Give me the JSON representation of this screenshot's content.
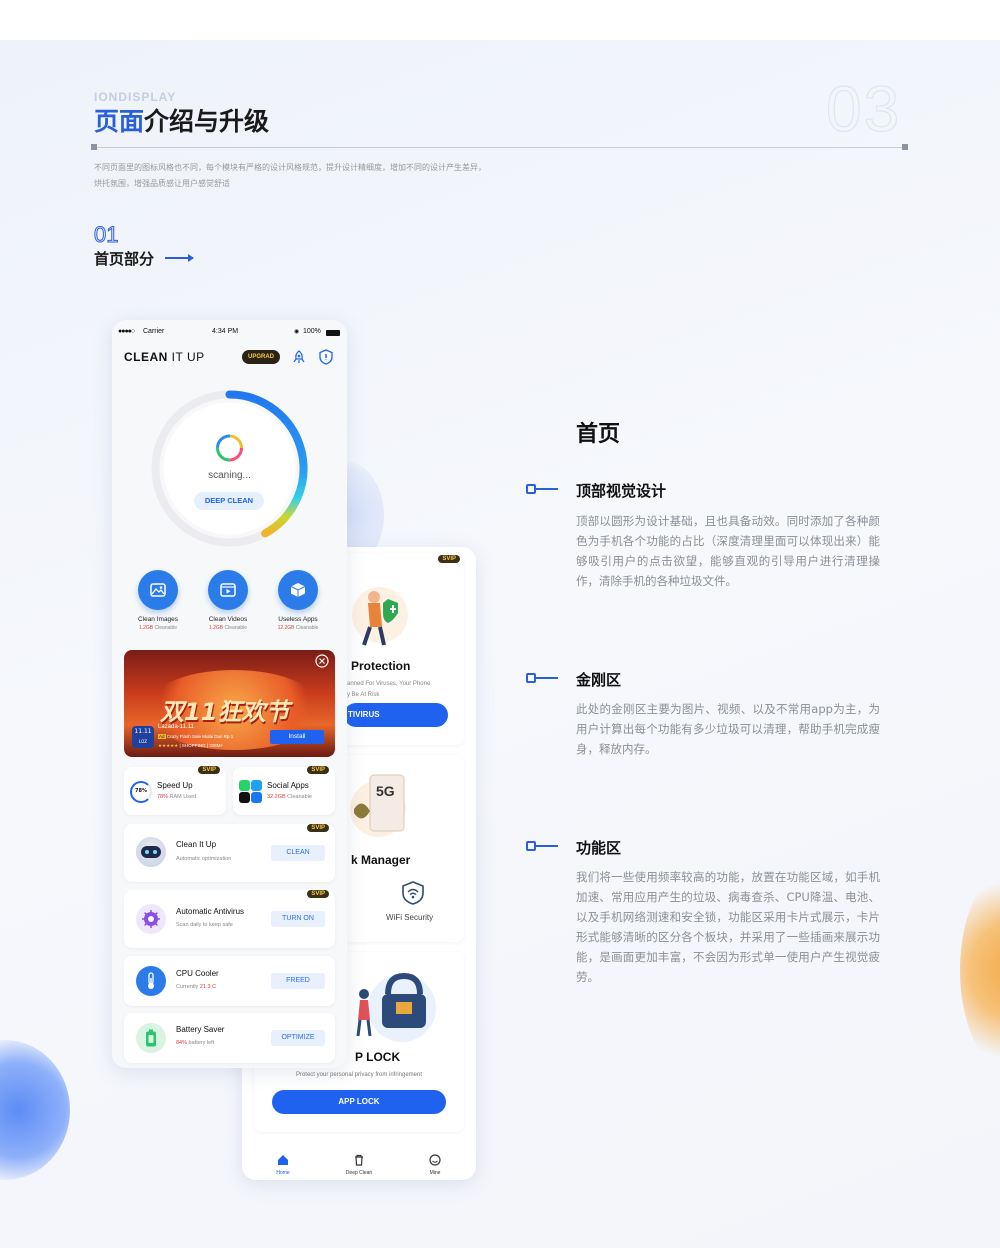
{
  "header": {
    "en_label": "IONDISPLAY",
    "title_highlight": "页面",
    "title_rest": "介绍与升级",
    "page_number": "03",
    "description_line1": "不同页面里的图标风格也不同，每个模块有严格的设计风格规范，提升设计精细度，增加不同的设计产生差异，",
    "description_line2": "烘托氛围，增强品质感让用户感觉舒适"
  },
  "section": {
    "number": "01",
    "title": "首页部分"
  },
  "phone_main": {
    "status": {
      "carrier": "Carrier",
      "time": "4:34 PM",
      "battery": "100%"
    },
    "logo_bold": "CLEAN",
    "logo_light": " IT UP",
    "upgrade_label": "UPGRAD",
    "gauge": {
      "status_text": "scaning...",
      "button_label": "DEEP CLEAN",
      "progress": 0.42
    },
    "features": [
      {
        "title": "Clean Images",
        "value": "1.2GB",
        "unit": " Cleanable",
        "icon": "image-icon"
      },
      {
        "title": "Clean Videos",
        "value": "1.2GB",
        "unit": " Cleanable",
        "icon": "video-icon"
      },
      {
        "title": "Useless Apps",
        "value": "12.2GB",
        "unit": " Cleanable",
        "icon": "box-icon"
      }
    ],
    "ad": {
      "banner_text": "双11狂欢节",
      "brand_small": "11.11",
      "brand_name": "Lazada-11.11",
      "ad_tag": "Ad",
      "ad_desc": "Crazy Flash Sale Mulai Dari Rp 1",
      "rating_text": "| SHOPPING | 328M+",
      "install_label": "Install",
      "logo_label": "LOZ"
    },
    "speed_card": {
      "badge": "SVIP",
      "title": "Speed Up",
      "percent": "78%",
      "value": "78%",
      "unit": " RAM Used"
    },
    "social_card": {
      "badge": "SVIP",
      "title": "Social Apps",
      "value": "32.2GB",
      "unit": " Cleanable"
    },
    "clean_card": {
      "badge": "SVIP",
      "title": "Clean It Up",
      "sub": "Automatic optimization",
      "action": "CLEAN"
    },
    "antivirus_card": {
      "badge": "SVIP",
      "title": "Automatic Antivirus",
      "sub": "Scan daily to keep safe",
      "action": "TURN ON"
    },
    "cpu_card": {
      "title": "CPU Cooler",
      "sub_prefix": "Currently ",
      "value": "21.3 C",
      "action": "FREED"
    },
    "battery_card": {
      "title": "Battery Saver",
      "value": "84%",
      "unit": " battery left",
      "action": "OPTIMIZE"
    }
  },
  "phone_back": {
    "protection": {
      "badge": "SVIP",
      "title": "Protection",
      "sub_line1": "anned For Viruses, Your Phone",
      "sub_line2": "y Be At Risk",
      "button": "TIVIRUS"
    },
    "network": {
      "network_label": "5G",
      "title": "k Manager",
      "wifi_label": "WiFi Security"
    },
    "applock": {
      "title": "P LOCK",
      "sub": "Protect your personal privacy from infringement",
      "button": "APP LOCK"
    },
    "nav": [
      {
        "label": "Home",
        "icon": "home-icon",
        "active": true
      },
      {
        "label": "Deep Clean",
        "icon": "trash-icon",
        "active": false
      },
      {
        "label": "Mine",
        "icon": "smile-icon",
        "active": false
      }
    ]
  },
  "right": {
    "title": "首页",
    "items": [
      {
        "heading": "顶部视觉设计",
        "body": "顶部以圆形为设计基础，且也具备动效。同时添加了各种颜色为手机各个功能的占比（深度清理里面可以体现出来）能够吸引用户的点击欲望，能够直观的引导用户进行清理操作，清除手机的各种垃圾文件。"
      },
      {
        "heading": "金刚区",
        "body": "此处的金刚区主要为图片、视频、以及不常用app为主，为用户计算出每个功能有多少垃圾可以清理，帮助手机完成瘦身，释放内存。"
      },
      {
        "heading": "功能区",
        "body": "我们将一些使用频率较高的功能，放置在功能区域，如手机加速、常用应用产生的垃圾、病毒查杀、CPU降温、电池、以及手机网络测速和安全锁，功能区采用卡片式展示，卡片形式能够清晰的区分各个板块，并采用了一些插画来展示功能，是画面更加丰富，不会因为形式单一使用户产生视觉疲劳。"
      }
    ]
  },
  "colors": {
    "accent": "#2a5fd8",
    "button_blue": "#1f62f0",
    "svip_bg": "#3b3016",
    "svip_text": "#f5c84a",
    "alert_red": "#e43b3b"
  }
}
